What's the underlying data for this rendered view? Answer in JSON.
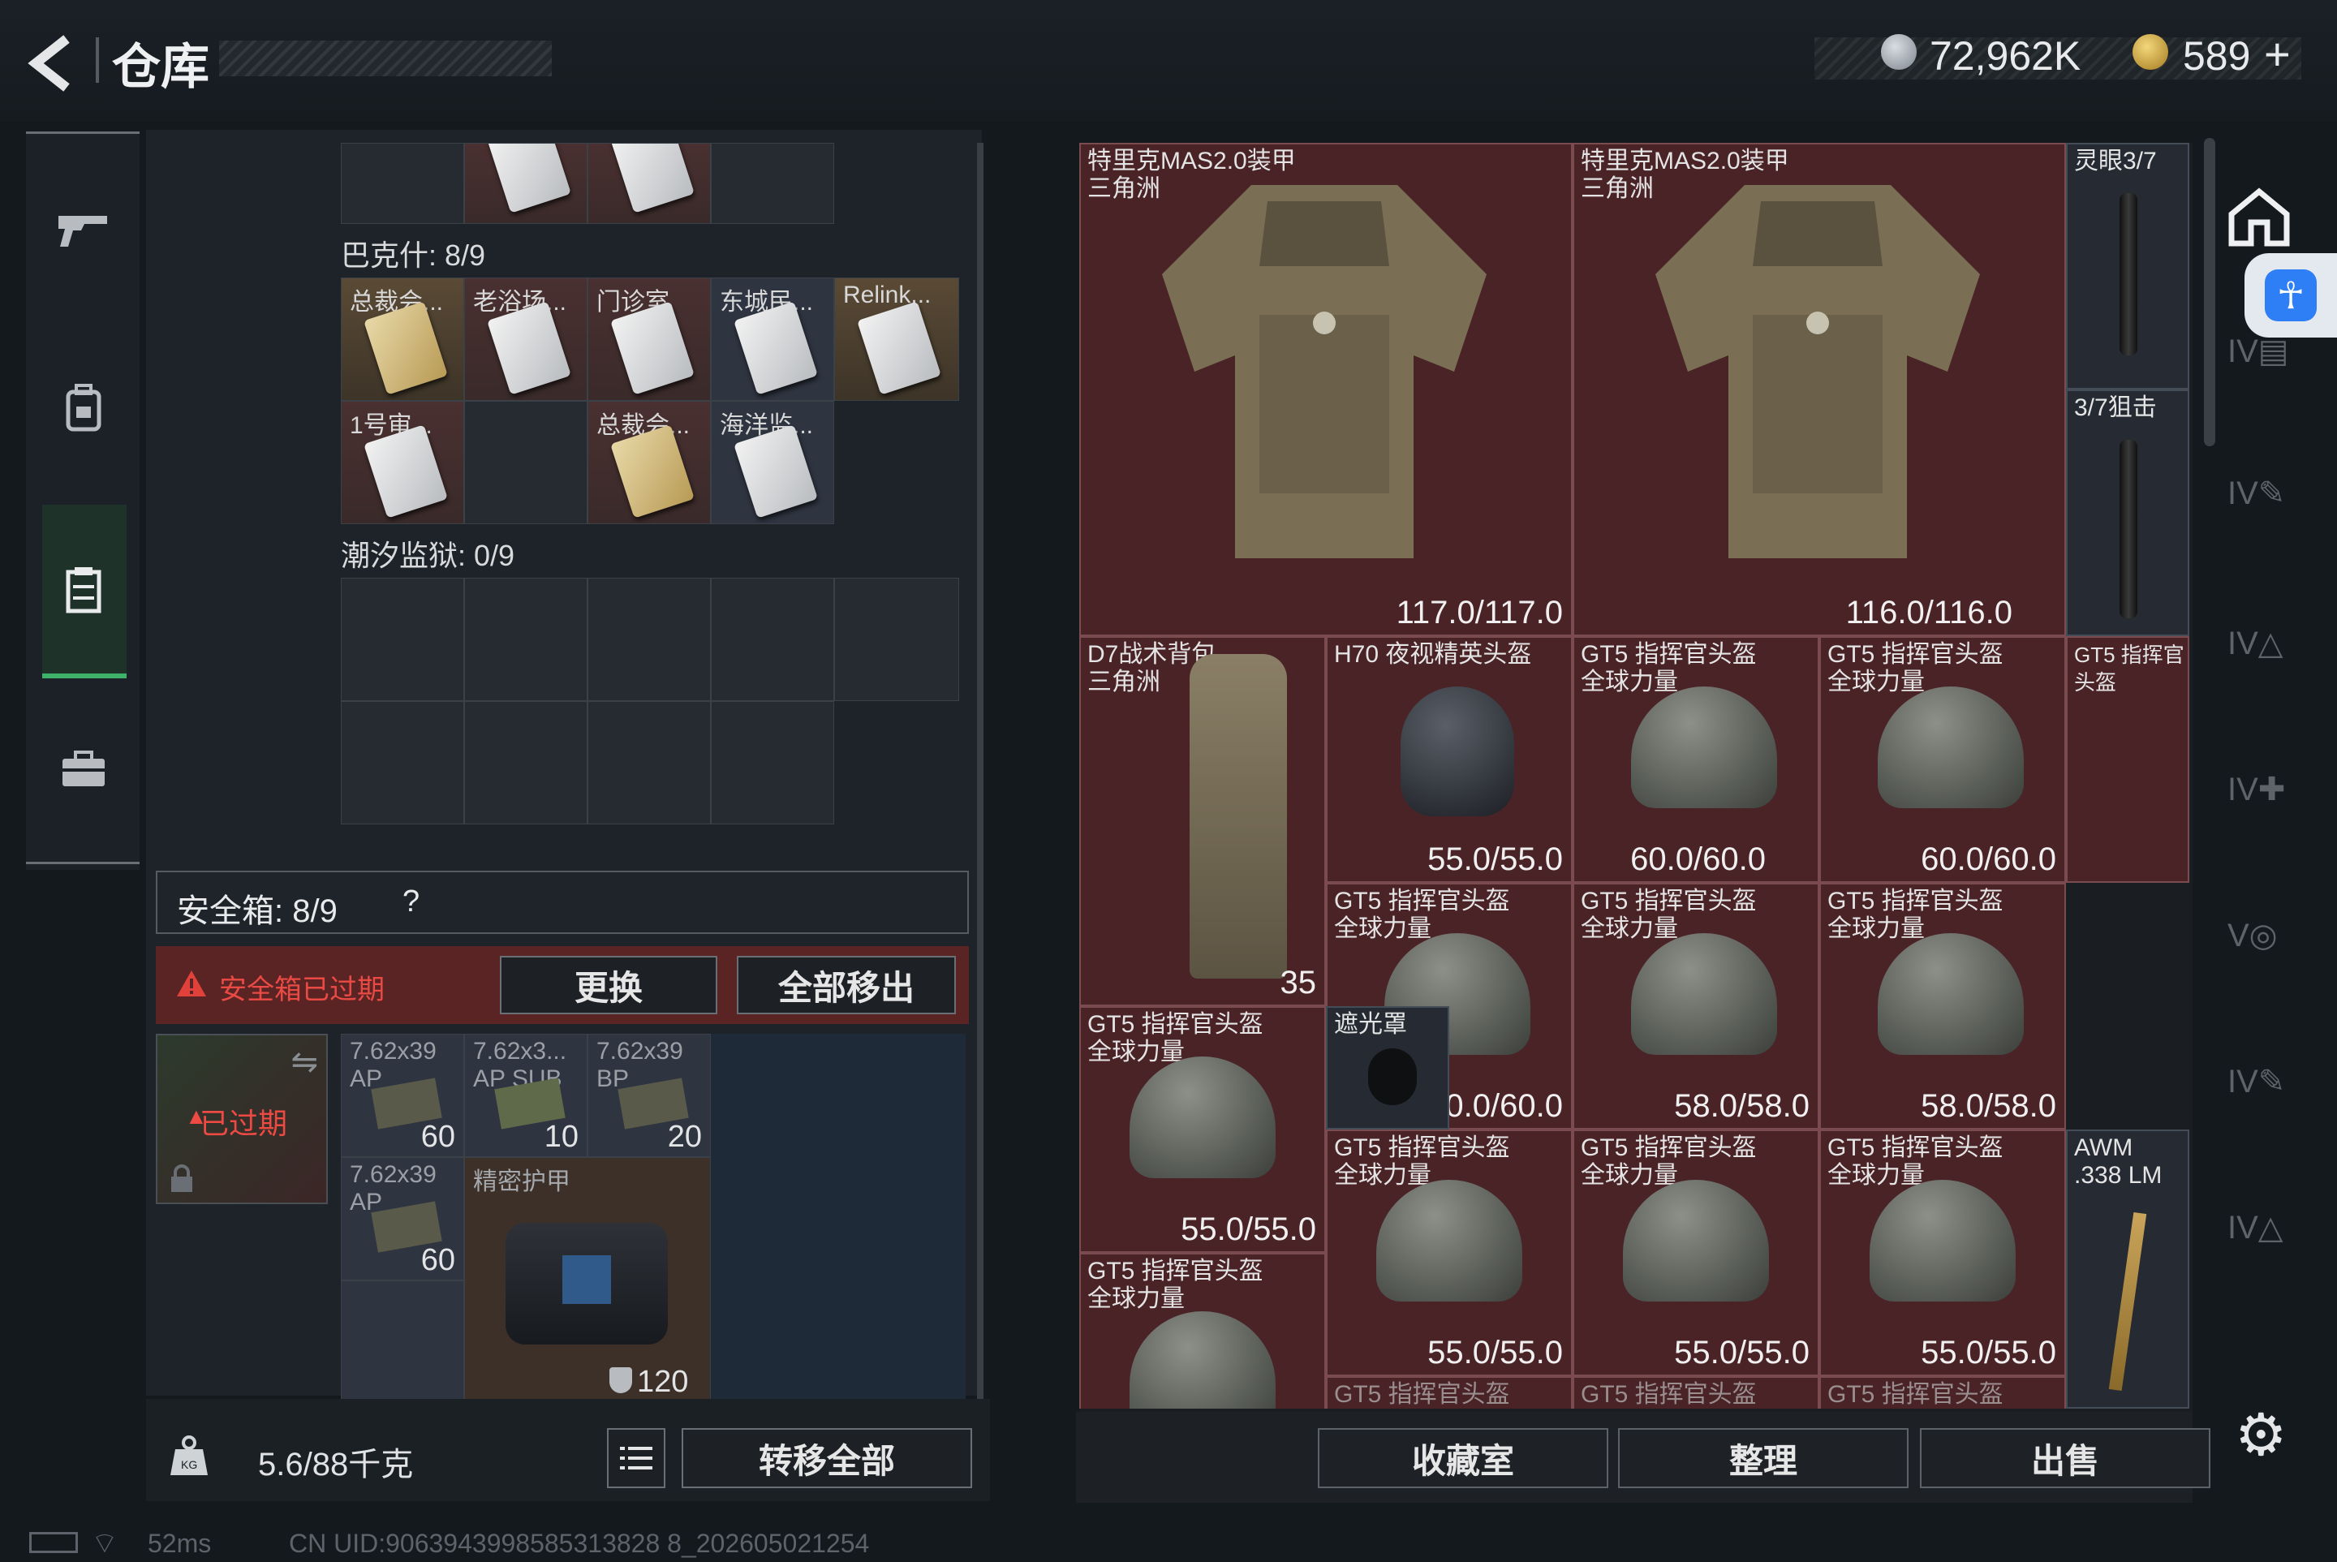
{
  "header": {
    "title": "仓库",
    "currency_silver": "72,962K",
    "currency_gold": "589",
    "gold_add_symbol": "+"
  },
  "left_panel": {
    "sections": [
      {
        "label": "巴克什: 8/9"
      },
      {
        "label": "潮汐监狱: 0/9"
      }
    ],
    "bakshi_items": [
      "总裁会...",
      "老浴场...",
      "门诊室",
      "东城民...",
      "Relink...",
      "1号审...",
      "总裁会...",
      "海洋监..."
    ],
    "safe_box": {
      "label": "安全箱: 8/9",
      "help": "?",
      "expired_msg": "安全箱已过期",
      "replace_button": "更换",
      "remove_all_button": "全部移出",
      "expired_tag": "已过期"
    },
    "ammo": [
      {
        "name": "7.62x39",
        "sub": "AP",
        "count": "60"
      },
      {
        "name": "7.62x3...",
        "sub": "AP SUB",
        "count": "10"
      },
      {
        "name": "7.62x39",
        "sub": "BP",
        "count": "20"
      },
      {
        "name": "7.62x39",
        "sub": "AP",
        "count": "60"
      }
    ],
    "armor_item": {
      "name": "精密护甲",
      "value": "120"
    },
    "weight": "5.6/88千克",
    "transfer_all_button": "转移全部"
  },
  "stash": {
    "items": [
      {
        "name": "特里克MAS2.0装甲",
        "sub": "三角洲",
        "durability": "117.0/117.0"
      },
      {
        "name": "特里克MAS2.0装甲",
        "sub": "三角洲",
        "durability": "116.0/116.0"
      },
      {
        "name": "灵眼3/7",
        "sub": "",
        "durability": ""
      },
      {
        "name": "3/7狙击",
        "sub": "",
        "durability": ""
      },
      {
        "name": "D7战术背包",
        "sub": "三角洲",
        "durability": "35"
      },
      {
        "name": "H70 夜视精英头盔",
        "sub": "",
        "durability": "55.0/55.0"
      },
      {
        "name": "GT5 指挥官头盔",
        "sub": "全球力量",
        "durability": "60.0/60.0"
      },
      {
        "name": "GT5 指挥官头盔",
        "sub": "全球力量",
        "durability": "60.0/60.0"
      },
      {
        "name": "GT5 指挥官头盔",
        "sub": "全球力量",
        "durability": "60.0/60.0"
      },
      {
        "name": "GT5 指挥官头盔",
        "sub": "全球力量",
        "durability": "58.0/58.0"
      },
      {
        "name": "GT5 指挥官头盔",
        "sub": "全球力量",
        "durability": "58.0/58.0"
      },
      {
        "name": "GT5 指挥官头盔",
        "sub": "全球力量",
        "durability": "55.0/55.0"
      },
      {
        "name": "遮光罩",
        "sub": "",
        "durability": ""
      },
      {
        "name": "GT5 指挥官头盔",
        "sub": "全球力量",
        "durability": "55.0/55.0"
      },
      {
        "name": "GT5 指挥官头盔",
        "sub": "全球力量",
        "durability": "55.0/55.0"
      },
      {
        "name": "GT5 指挥官头盔",
        "sub": "全球力量",
        "durability": "55.0/55.0"
      },
      {
        "name": "AWM",
        "sub": ".338 LM",
        "durability": ""
      },
      {
        "name": "GT5 指挥官头盔",
        "sub": "全球力量",
        "durability": ""
      },
      {
        "name": "GT5 指挥官头盔",
        "sub": "",
        "durability": ""
      },
      {
        "name": "GT5 指挥官头盔",
        "sub": "",
        "durability": ""
      },
      {
        "name": "GT5 指挥官头盔",
        "sub": "",
        "durability": ""
      }
    ],
    "collection_button": "收藏室",
    "sort_button": "整理",
    "sell_button": "出售"
  },
  "status": {
    "ping": "52ms",
    "uid": "CN UID:9063943998585313828 8_202605021254"
  }
}
